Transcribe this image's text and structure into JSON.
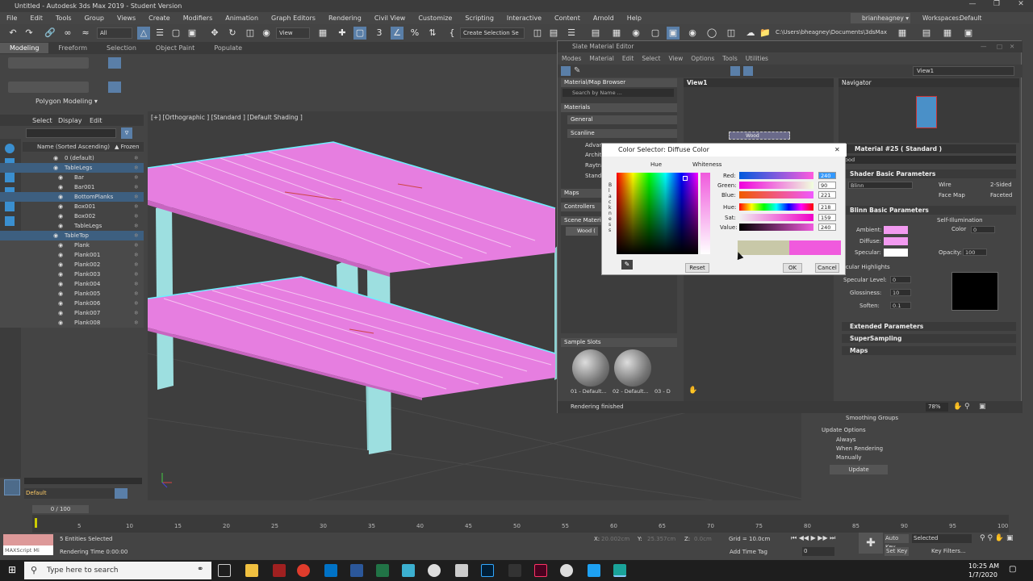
{
  "app": {
    "title": "Untitled - Autodesk 3ds Max 2019 - Student Version",
    "user": "brianheagney",
    "workspaces_label": "Workspaces:",
    "workspace": "Default"
  },
  "menu": [
    "File",
    "Edit",
    "Tools",
    "Group",
    "Views",
    "Create",
    "Modifiers",
    "Animation",
    "Graph Editors",
    "Rendering",
    "Civil View",
    "Customize",
    "Scripting",
    "Interactive",
    "Content",
    "Arnold",
    "Help"
  ],
  "toolbar": {
    "filter": "All",
    "view": "View",
    "selection_set": "Create Selection Se",
    "path": "C:\\Users\\bheagney\\Documents\\3dsMax"
  },
  "ribbon": {
    "tabs": [
      "Modeling",
      "Freeform",
      "Selection",
      "Object Paint",
      "Populate"
    ],
    "panel_label": "Polygon Modeling"
  },
  "scene_explorer": {
    "tabs": [
      "Select",
      "Display",
      "Edit"
    ],
    "col_name": "Name (Sorted Ascending)",
    "col_frozen": "▲ Frozen",
    "items": [
      "0 (default)",
      "TableLegs",
      "Bar",
      "Bar001",
      "BottomPlanks",
      "Box001",
      "Box002",
      "TableLegs",
      "TableTop",
      "Plank",
      "Plank001",
      "Plank002",
      "Plank003",
      "Plank004",
      "Plank005",
      "Plank006",
      "Plank007",
      "Plank008"
    ],
    "layer": "Default"
  },
  "viewport": {
    "label": "[+] [Orthographic ] [Standard ] [Default Shading ]"
  },
  "sme": {
    "title": "Slate Material Editor",
    "menu": [
      "Modes",
      "Material",
      "Edit",
      "Select",
      "View",
      "Options",
      "Tools",
      "Utilities"
    ],
    "view_dropdown": "View1",
    "browser_title": "Material/Map Browser",
    "search_placeholder": "Search by Name ...",
    "browser_items": [
      "Materials",
      "General",
      "Scanline",
      "Advan",
      "Archit",
      "Raytra",
      "Stand",
      "Maps",
      "Controllers",
      "Scene Materi",
      "Wood ("
    ],
    "view_tab": "View1",
    "node_label": "Wood",
    "navigator": "Navigator",
    "sample_slots_label": "Sample Slots",
    "sample_slots": [
      "01 - Default...",
      "02 - Default...",
      "03 - D"
    ],
    "status": "Rendering finished",
    "zoom": "78%",
    "material_name": "Material #25  ( Standard )",
    "material_field": "ood",
    "shader_rollout": "Shader Basic Parameters",
    "shader": "Blinn",
    "wire": "Wire",
    "two_sided": "2-Sided",
    "face_map": "Face Map",
    "faceted": "Faceted",
    "blinn_rollout": "Blinn Basic Parameters",
    "self_illum": "Self-Illumination",
    "color_label": "Color",
    "color_value": "0",
    "ambient": "Ambient:",
    "diffuse": "Diffuse:",
    "specular": "Specular:",
    "opacity": "Opacity:",
    "opacity_value": "100",
    "spec_highlights": "pecular Highlights",
    "spec_level": "Specular Level:",
    "spec_level_value": "0",
    "glossiness": "Glossiness:",
    "glossiness_value": "10",
    "soften": "Soften:",
    "soften_value": "0.1",
    "extended": "Extended Parameters",
    "supersampling": "SuperSampling",
    "maps": "Maps",
    "smoothing_groups": "Smoothing Groups",
    "update_options": "Update Options",
    "always": "Always",
    "when_rendering": "When Rendering",
    "manually": "Manually",
    "update_button": "Update"
  },
  "color_dialog": {
    "title": "Color Selector: Diffuse Color",
    "hue_label": "Hue",
    "whiteness_label": "Whiteness",
    "blackness_letters": [
      "B",
      "l",
      "a",
      "c",
      "k",
      "n",
      "e",
      "s",
      "s"
    ],
    "red_label": "Red:",
    "red": "240",
    "green_label": "Green:",
    "green": "90",
    "blue_label": "Blue:",
    "blue": "221",
    "hue_f_label": "Hue:",
    "hue": "218",
    "sat_label": "Sat:",
    "sat": "159",
    "value_label": "Value:",
    "value": "240",
    "reset": "Reset",
    "ok": "OK",
    "cancel": "Cancel",
    "old_color": "#c8c8a8",
    "new_color": "#f05add"
  },
  "status_bar": {
    "frame": "0 / 100",
    "entities": "5 Entities Selected",
    "rendering_time": "Rendering Time  0:00:00",
    "maxscript": "MAXScript Mi",
    "x_label": "X:",
    "x_value": "20.002cm",
    "y_label": "Y:",
    "y_value": "25.357cm",
    "z_label": "Z:",
    "z_value": "0.0cm",
    "grid": "Grid = 10.0cm",
    "add_time_tag": "Add Time Tag",
    "auto_key": "Auto Key",
    "selected": "Selected",
    "set_key": "Set Key",
    "key_filters": "Key Filters...",
    "frame_value": "0",
    "ticks": [
      "5",
      "10",
      "15",
      "20",
      "25",
      "30",
      "35",
      "40",
      "45",
      "50",
      "55",
      "60",
      "65",
      "70",
      "75",
      "80",
      "85",
      "90",
      "95",
      "100"
    ]
  },
  "taskbar": {
    "search_placeholder": "Type here to search",
    "time": "10:25 AM",
    "date": "1/7/2020"
  },
  "colors": {
    "pink": "#e67ee0",
    "cyan": "#9ddfe0",
    "selection_outline": "#6df0ff"
  }
}
